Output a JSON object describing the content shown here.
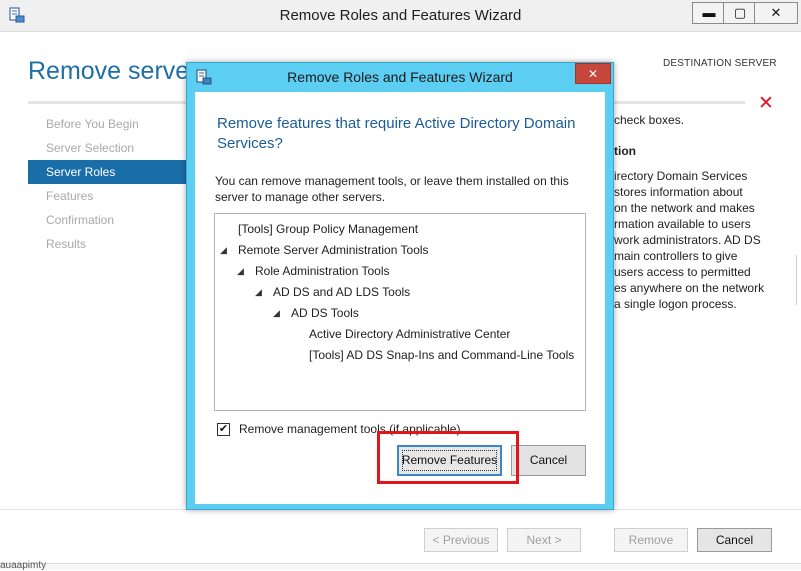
{
  "outer_window": {
    "title": "Remove Roles and Features Wizard",
    "controls": {
      "minimize": "▬",
      "maximize": "▢",
      "close": "✕"
    },
    "heading": "Remove server",
    "destination_label": "DESTINATION SERVER",
    "error_icon": "✕",
    "nav": [
      {
        "label": "Before You Begin",
        "active": false
      },
      {
        "label": "Server Selection",
        "active": false
      },
      {
        "label": "Server Roles",
        "active": true
      },
      {
        "label": "Features",
        "active": false
      },
      {
        "label": "Confirmation",
        "active": false
      },
      {
        "label": "Results",
        "active": false
      }
    ],
    "right_panel": {
      "top_text": "check boxes.",
      "subheading": "tion",
      "description_lines": [
        "irectory Domain Services",
        "stores information about",
        "on the network and makes",
        "rmation available to users",
        "work administrators. AD DS",
        "main controllers to give",
        "users access to permitted",
        "es anywhere on the network",
        "a single logon process."
      ]
    },
    "buttons": {
      "previous": "< Previous",
      "next": "Next >",
      "remove": "Remove",
      "cancel": "Cancel"
    },
    "bottom_text": "auaapimty"
  },
  "dialog": {
    "title": "Remove Roles and Features Wizard",
    "close": "✕",
    "heading": "Remove features that require Active Directory Domain Services?",
    "description": "You can remove management tools, or leave them installed on this server to manage other servers.",
    "tree": [
      {
        "label": "[Tools] Group Policy Management",
        "level": 0,
        "expanded": false
      },
      {
        "label": "Remote Server Administration Tools",
        "level": 0,
        "expanded": true
      },
      {
        "label": "Role Administration Tools",
        "level": 1,
        "expanded": true
      },
      {
        "label": "AD DS and AD LDS Tools",
        "level": 2,
        "expanded": true
      },
      {
        "label": "AD DS Tools",
        "level": 3,
        "expanded": true
      },
      {
        "label": "Active Directory Administrative Center",
        "level": 4,
        "expanded": false
      },
      {
        "label": "[Tools] AD DS Snap-Ins and Command-Line Tools",
        "level": 4,
        "expanded": false
      }
    ],
    "checkbox": {
      "label": "Remove management tools (if applicable)",
      "checked": true,
      "mark": "✔"
    },
    "buttons": {
      "remove_features": "Remove Features",
      "cancel": "Cancel"
    }
  },
  "colors": {
    "heading_blue": "#1f6fa5",
    "nav_active": "#1a6ea8",
    "dialog_frame": "#5ccef2",
    "dialog_close": "#c7463b",
    "highlight_red": "#e2151b"
  }
}
